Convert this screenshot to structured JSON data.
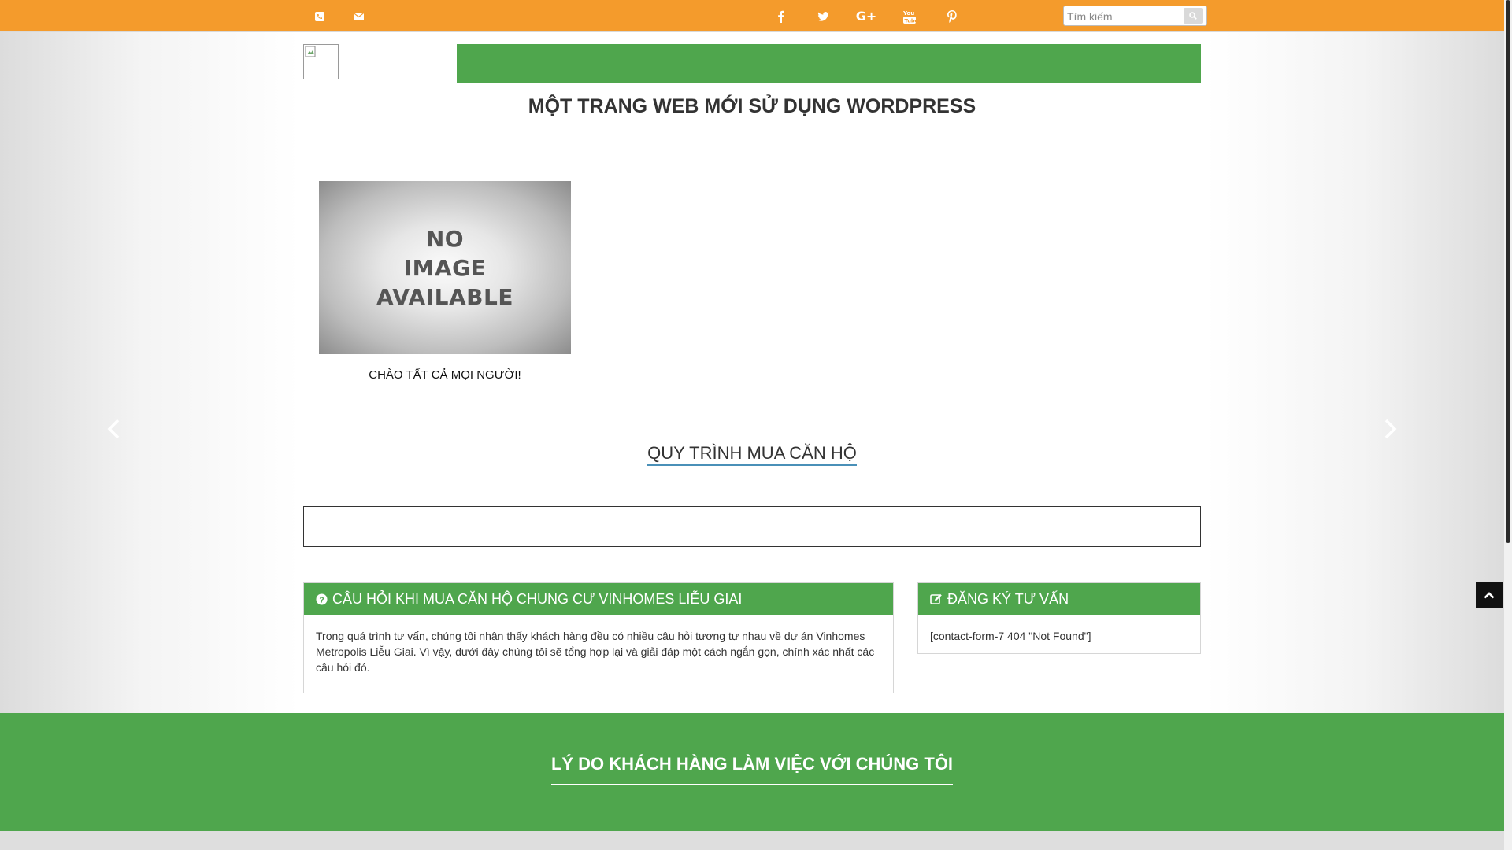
{
  "topbar": {
    "phone_icon": "phone-icon",
    "email_icon": "envelope-icon",
    "social": [
      "facebook-icon",
      "twitter-icon",
      "google-plus-icon",
      "youtube-icon",
      "pinterest-icon"
    ],
    "search_placeholder": "Tìm kiếm",
    "colors": {
      "bar": "#f49b2c"
    }
  },
  "header": {
    "site_title": "MỘT TRANG WEB MỚI SỬ DỤNG WORDPRESS",
    "nav_color": "#4fa64d"
  },
  "post": {
    "image_text_1": "NO",
    "image_text_2": "IMAGE",
    "image_text_3": "AVAILABLE",
    "title": "CHÀO TẤT CẢ MỌI NGƯỜI!"
  },
  "process": {
    "title": "QUY TRÌNH MUA CĂN HỘ"
  },
  "faq": {
    "heading": "CÂU HỎI KHI MUA CĂN HỘ CHUNG CƯ VINHOMES LIỄU GIAI",
    "body": "Trong quá trình tư vấn, chúng tôi nhận thấy khách hàng đều có nhiều câu hỏi tương tự nhau về dự án Vinhomes Metropolis Liễu Giai. Vì vậy, dưới đây chúng tôi sẽ tổng hợp lại và giải đáp một cách ngắn gọn, chính xác nhất các câu hỏi đó."
  },
  "register": {
    "heading": "ĐĂNG KÝ TƯ VẤN",
    "body": "[contact-form-7 404 \"Not Found\"]"
  },
  "reasons": {
    "title": "LÝ DO KHÁCH HÀNG LÀM VIỆC VỚI CHÚNG TÔI"
  }
}
